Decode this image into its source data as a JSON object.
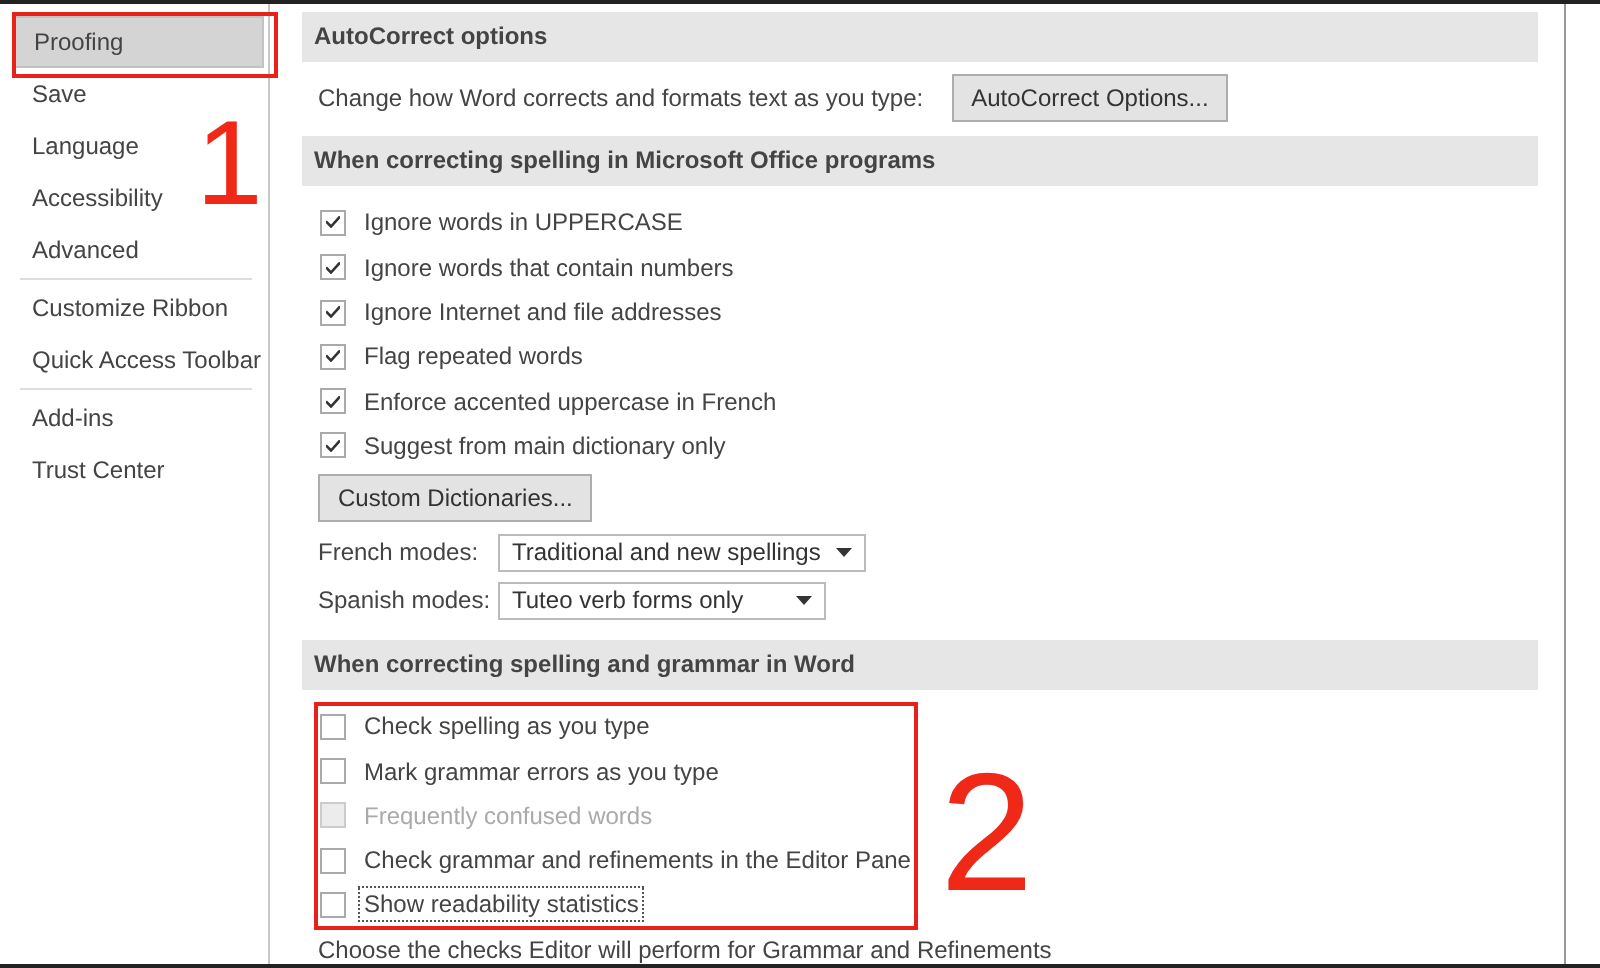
{
  "sidebar": {
    "groups": [
      {
        "items": [
          {
            "label": "Proofing",
            "selected": true
          },
          {
            "label": "Save",
            "selected": false
          },
          {
            "label": "Language",
            "selected": false
          },
          {
            "label": "Accessibility",
            "selected": false
          },
          {
            "label": "Advanced",
            "selected": false
          }
        ]
      },
      {
        "items": [
          {
            "label": "Customize Ribbon",
            "selected": false
          },
          {
            "label": "Quick Access Toolbar",
            "selected": false
          }
        ]
      },
      {
        "items": [
          {
            "label": "Add-ins",
            "selected": false
          },
          {
            "label": "Trust Center",
            "selected": false
          }
        ]
      }
    ]
  },
  "sections": [
    {
      "title": "AutoCorrect options",
      "rows": [
        {
          "kind": "text-button",
          "text": "Change how Word corrects and formats text as you type:",
          "button": "AutoCorrect Options..."
        }
      ]
    },
    {
      "title": "When correcting spelling in Microsoft Office programs",
      "rows": [
        {
          "kind": "checkbox",
          "label": "Ignore words in UPPERCASE",
          "checked": true,
          "disabled": false,
          "focused": false
        },
        {
          "kind": "checkbox",
          "label": "Ignore words that contain numbers",
          "checked": true,
          "disabled": false,
          "focused": false
        },
        {
          "kind": "checkbox",
          "label": "Ignore Internet and file addresses",
          "checked": true,
          "disabled": false,
          "focused": false
        },
        {
          "kind": "checkbox",
          "label": "Flag repeated words",
          "checked": true,
          "disabled": false,
          "focused": false
        },
        {
          "kind": "checkbox",
          "label": "Enforce accented uppercase in French",
          "checked": true,
          "disabled": false,
          "focused": false
        },
        {
          "kind": "checkbox",
          "label": "Suggest from main dictionary only",
          "checked": true,
          "disabled": false,
          "focused": false
        },
        {
          "kind": "button",
          "button": "Custom Dictionaries..."
        },
        {
          "kind": "dropdown",
          "label": "French modes:",
          "value": "Traditional and new spellings",
          "wide": true
        },
        {
          "kind": "dropdown",
          "label": "Spanish modes:",
          "value": "Tuteo verb forms only",
          "wide": false
        }
      ]
    },
    {
      "title": "When correcting spelling and grammar in Word",
      "rows": [
        {
          "kind": "checkbox",
          "label": "Check spelling as you type",
          "checked": false,
          "disabled": false,
          "focused": false
        },
        {
          "kind": "checkbox",
          "label": "Mark grammar errors as you type",
          "checked": false,
          "disabled": false,
          "focused": false
        },
        {
          "kind": "checkbox",
          "label": "Frequently confused words",
          "checked": false,
          "disabled": true,
          "focused": false
        },
        {
          "kind": "checkbox",
          "label": "Check grammar and refinements in the Editor Pane",
          "checked": false,
          "disabled": false,
          "focused": false
        },
        {
          "kind": "checkbox",
          "label": "Show readability statistics",
          "checked": false,
          "disabled": false,
          "focused": true
        },
        {
          "kind": "text",
          "text": "Choose the checks Editor will perform for Grammar and Refinements"
        }
      ]
    }
  ],
  "annotations": [
    {
      "number": "1"
    },
    {
      "number": "2"
    }
  ]
}
